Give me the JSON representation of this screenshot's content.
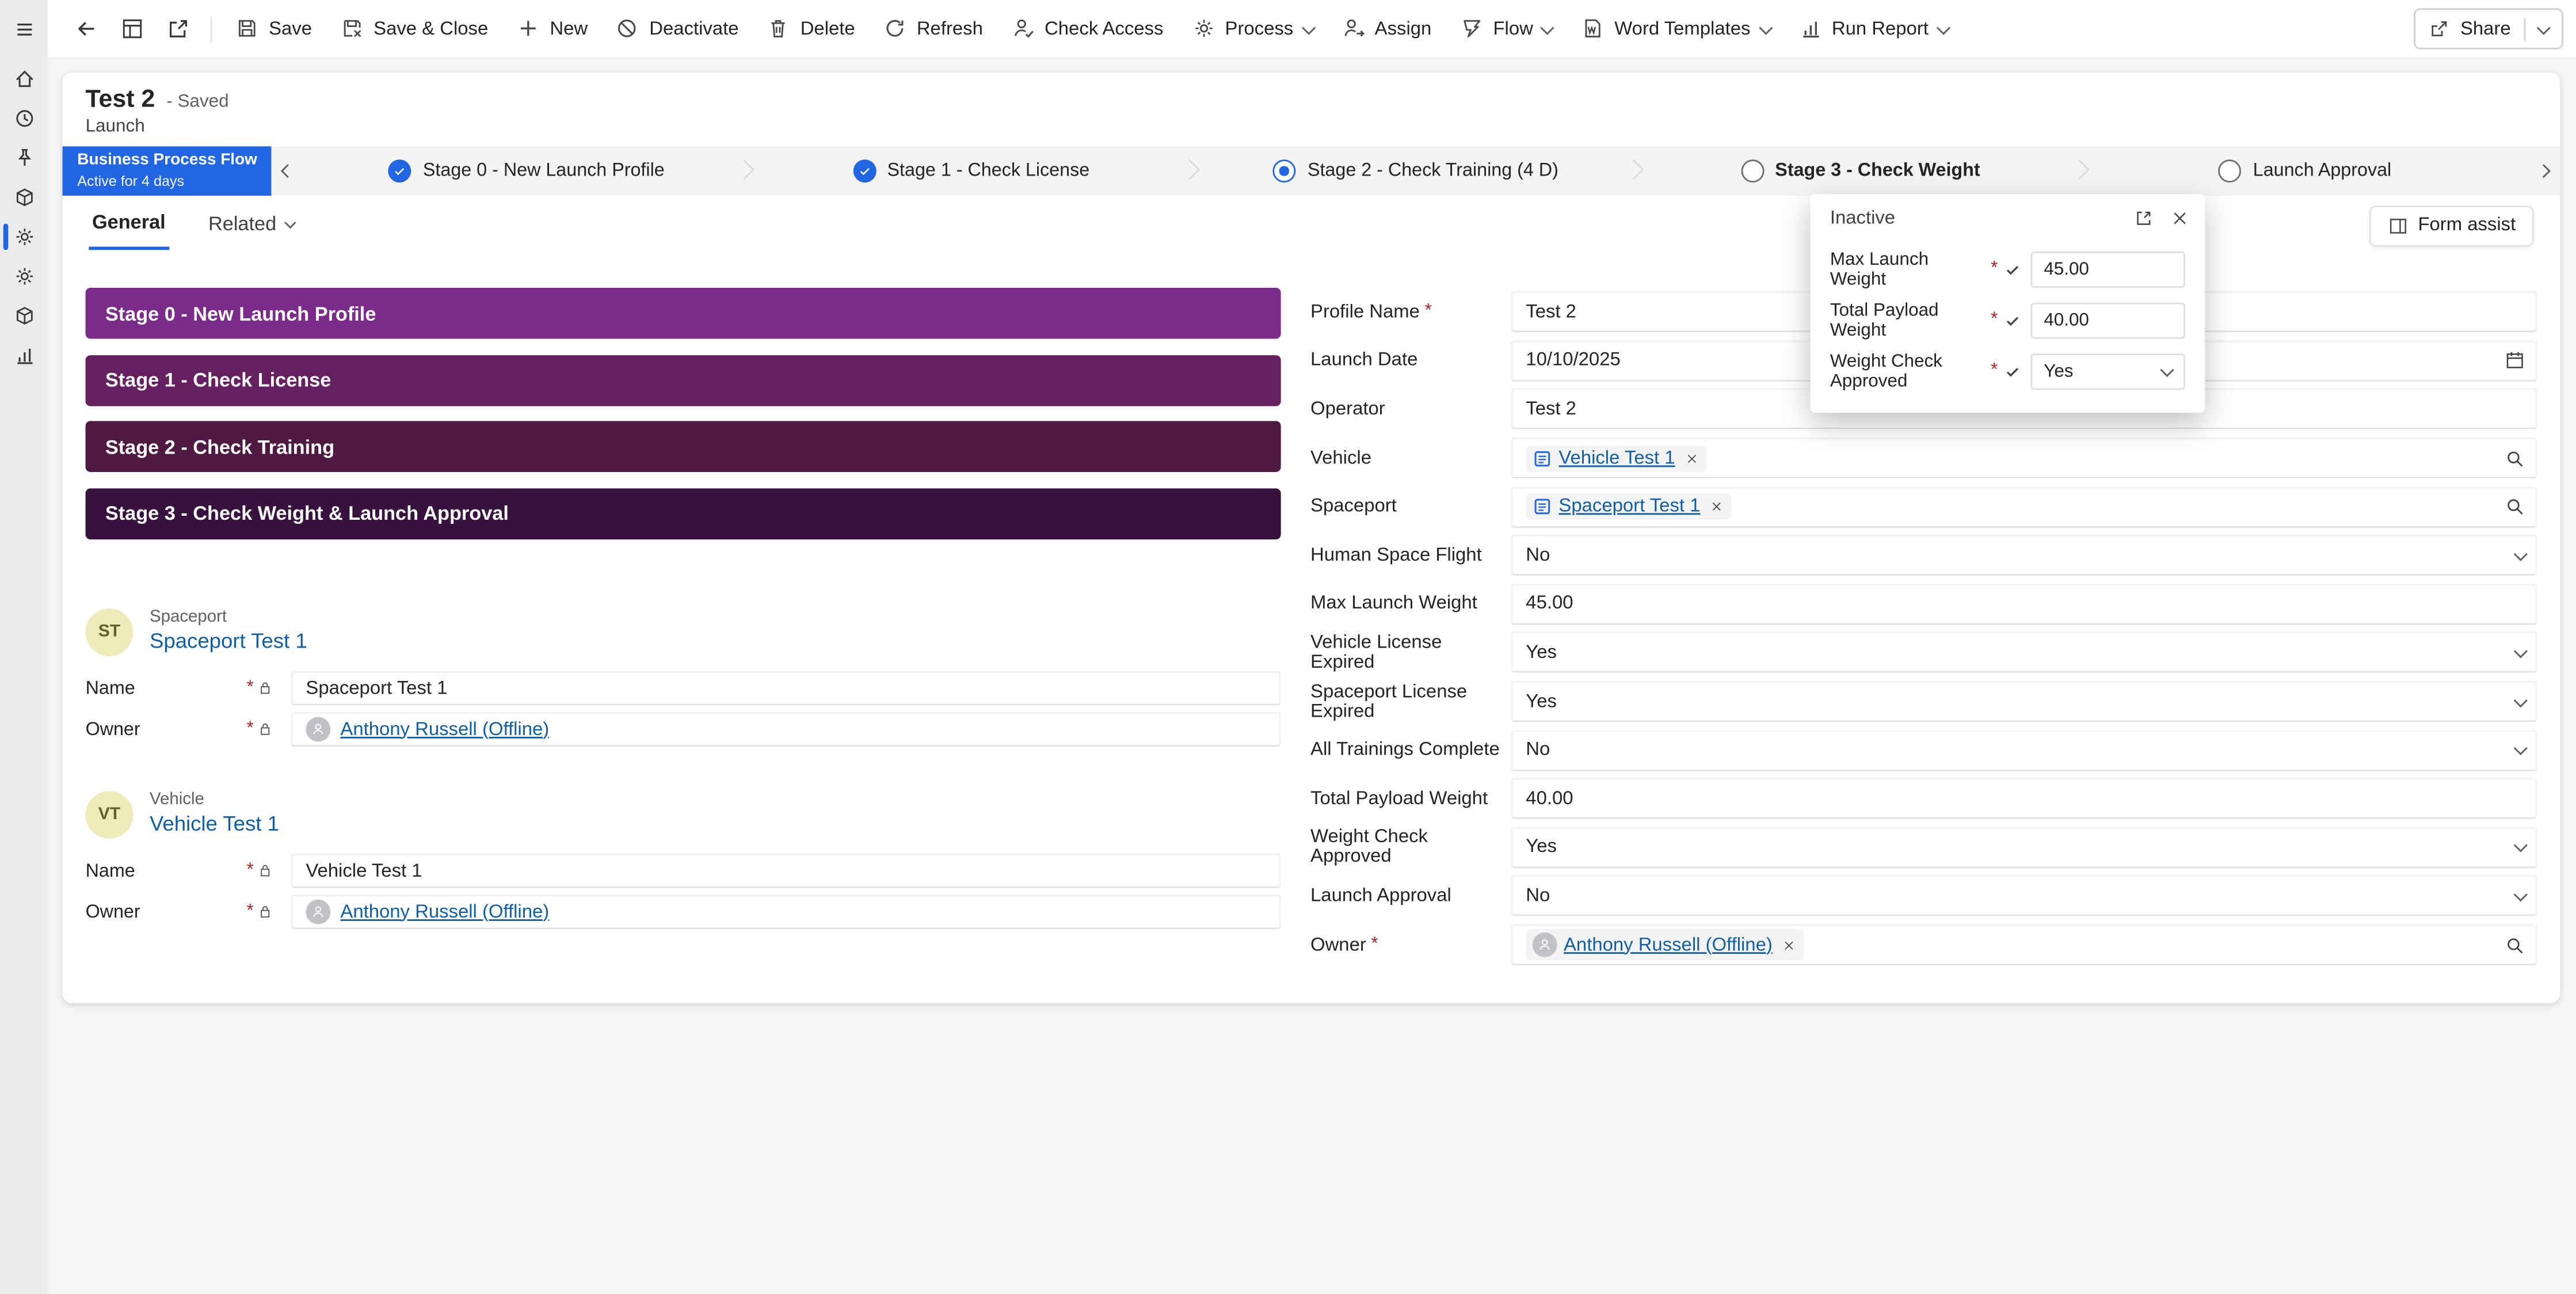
{
  "nav_rail": {
    "items": [
      {
        "icon": "home"
      },
      {
        "icon": "recent-clock"
      },
      {
        "icon": "pinned"
      },
      {
        "icon": "entity-cube"
      },
      {
        "icon": "process-gear",
        "active": true
      },
      {
        "icon": "settings-gear"
      },
      {
        "icon": "entity-cube-2"
      },
      {
        "icon": "reports-chart"
      }
    ]
  },
  "command_bar": {
    "share": {
      "label": "Share",
      "icon": "share-icon"
    },
    "items": [
      {
        "label": "Save",
        "icon": "save-icon"
      },
      {
        "label": "Save & Close",
        "icon": "save-close-icon"
      },
      {
        "label": "New",
        "icon": "plus-icon"
      },
      {
        "label": "Deactivate",
        "icon": "ban-icon"
      },
      {
        "label": "Delete",
        "icon": "trash-icon"
      },
      {
        "label": "Refresh",
        "icon": "refresh-icon"
      },
      {
        "label": "Check Access",
        "icon": "person-check-icon"
      },
      {
        "label": "Process",
        "icon": "gear-icon",
        "has_menu": true
      },
      {
        "label": "Assign",
        "icon": "person-arrow-icon"
      },
      {
        "label": "Flow",
        "icon": "flow-icon",
        "has_menu": true
      },
      {
        "label": "Word Templates",
        "icon": "word-doc-icon",
        "has_menu": true
      },
      {
        "label": "Run Report",
        "icon": "bar-chart-icon",
        "has_menu": true
      }
    ]
  },
  "record_header": {
    "title": "Test 2",
    "status": "- Saved",
    "entity_type": "Launch"
  },
  "bpf": {
    "badge_title": "Business Process Flow",
    "badge_subtitle": "Active for 4 days",
    "stages": [
      {
        "label": "Stage 0 - New Launch Profile",
        "state": "completed"
      },
      {
        "label": "Stage 1 - Check License",
        "state": "completed"
      },
      {
        "label": "Stage 2 -  Check Training  (4 D)",
        "state": "active"
      },
      {
        "label": "Stage 3 - Check Weight",
        "state": "upcoming",
        "selected": true
      },
      {
        "label": "Launch Approval",
        "state": "upcoming"
      }
    ]
  },
  "stage_flyout": {
    "status": "Inactive",
    "required_marker": "*",
    "fields": [
      {
        "label": "Max Launch Weight",
        "value": "45.00",
        "type": "text"
      },
      {
        "label": "Total Payload Weight",
        "value": "40.00",
        "type": "text"
      },
      {
        "label": "Weight Check Approved",
        "value": "Yes",
        "type": "dropdown"
      }
    ]
  },
  "tabs": {
    "items": [
      {
        "label": "General",
        "active": true
      },
      {
        "label": "Related",
        "has_menu": true
      }
    ],
    "form_assist_label": "Form assist"
  },
  "form": {
    "required_marker": "*",
    "stage_banners": [
      {
        "label": "Stage 0 - New Launch Profile",
        "color": "#7B2C88",
        "style": "background-color:#7B2C88"
      },
      {
        "label": "Stage 1 - Check License",
        "color": "#67205F",
        "style": "background-color:#67205F"
      },
      {
        "label": "Stage 2 - Check Training",
        "color": "#4F1A41",
        "style": "background-color:#4F1A41"
      },
      {
        "label": "Stage 3 - Check Weight & Launch Approval",
        "color": "#37123E",
        "style": "background-color:#37123E"
      }
    ],
    "related_cards": [
      {
        "initials": "ST",
        "entity_label": "Spaceport",
        "title": "Spaceport Test 1",
        "rows": [
          {
            "label": "Name",
            "value": "Spaceport Test 1",
            "type": "text",
            "required": true,
            "locked": true
          },
          {
            "label": "Owner",
            "value": "Anthony Russell (Offline)",
            "type": "owner",
            "required": true,
            "locked": true
          }
        ]
      },
      {
        "initials": "VT",
        "entity_label": "Vehicle",
        "title": "Vehicle Test 1",
        "rows": [
          {
            "label": "Name",
            "value": "Vehicle Test 1",
            "type": "text",
            "required": true,
            "locked": true
          },
          {
            "label": "Owner",
            "value": "Anthony Russell (Offline)",
            "type": "owner",
            "required": true,
            "locked": true
          }
        ]
      }
    ],
    "fields": [
      {
        "label": "Profile Name",
        "value": "Test 2",
        "type": "text",
        "required": true
      },
      {
        "label": "Launch Date",
        "value": "10/10/2025",
        "type": "date"
      },
      {
        "label": "Operator",
        "value": "Test 2",
        "type": "text"
      },
      {
        "label": "Vehicle",
        "value": "Vehicle Test 1",
        "type": "lookup"
      },
      {
        "label": "Spaceport",
        "value": "Spaceport Test 1",
        "type": "lookup"
      },
      {
        "label": "Human Space Flight",
        "value": "No",
        "type": "dropdown"
      },
      {
        "label": "Max Launch Weight",
        "value": "45.00",
        "type": "text"
      },
      {
        "label": "Vehicle License Expired",
        "value": "Yes",
        "type": "dropdown"
      },
      {
        "label": "Spaceport License Expired",
        "value": "Yes",
        "type": "dropdown"
      },
      {
        "label": "All Trainings Complete",
        "value": "No",
        "type": "dropdown"
      },
      {
        "label": "Total Payload Weight",
        "value": "40.00",
        "type": "text"
      },
      {
        "label": "Weight Check Approved",
        "value": "Yes",
        "type": "dropdown"
      },
      {
        "label": "Launch Approval",
        "value": "No",
        "type": "dropdown"
      },
      {
        "label": "Owner",
        "value": "Anthony Russell (Offline)",
        "type": "owner-lookup",
        "required": true
      }
    ]
  },
  "colors": {
    "accent_blue": "#2266E3",
    "link_blue": "#115EA3",
    "required_red": "#A4262C",
    "rail_gray": "#EBEBEB",
    "page_gray": "#F5F5F5"
  }
}
